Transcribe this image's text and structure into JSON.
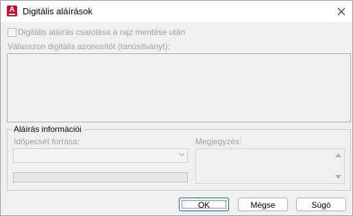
{
  "window": {
    "title": "Digitális aláírások",
    "app_icon_letter": "A"
  },
  "options": {
    "attach_signature_label": "Digitális aláírás csatolása a rajz mentése után",
    "attach_signature_checked": false,
    "select_id_label": "Válasszon digitális azonosítót (tanúsítványt):"
  },
  "signature_info": {
    "group_title": "Aláírás információi",
    "timestamp_label": "Időpecsét forrása:",
    "timestamp_value": "",
    "comment_label": "Megjegyzés:",
    "comment_value": ""
  },
  "buttons": {
    "ok": "OK",
    "cancel": "Mégse",
    "help": "Súgó"
  },
  "colors": {
    "app_icon": "#c8102e",
    "default_button_border": "#0067c0",
    "disabled_text": "#a0a0a0"
  }
}
